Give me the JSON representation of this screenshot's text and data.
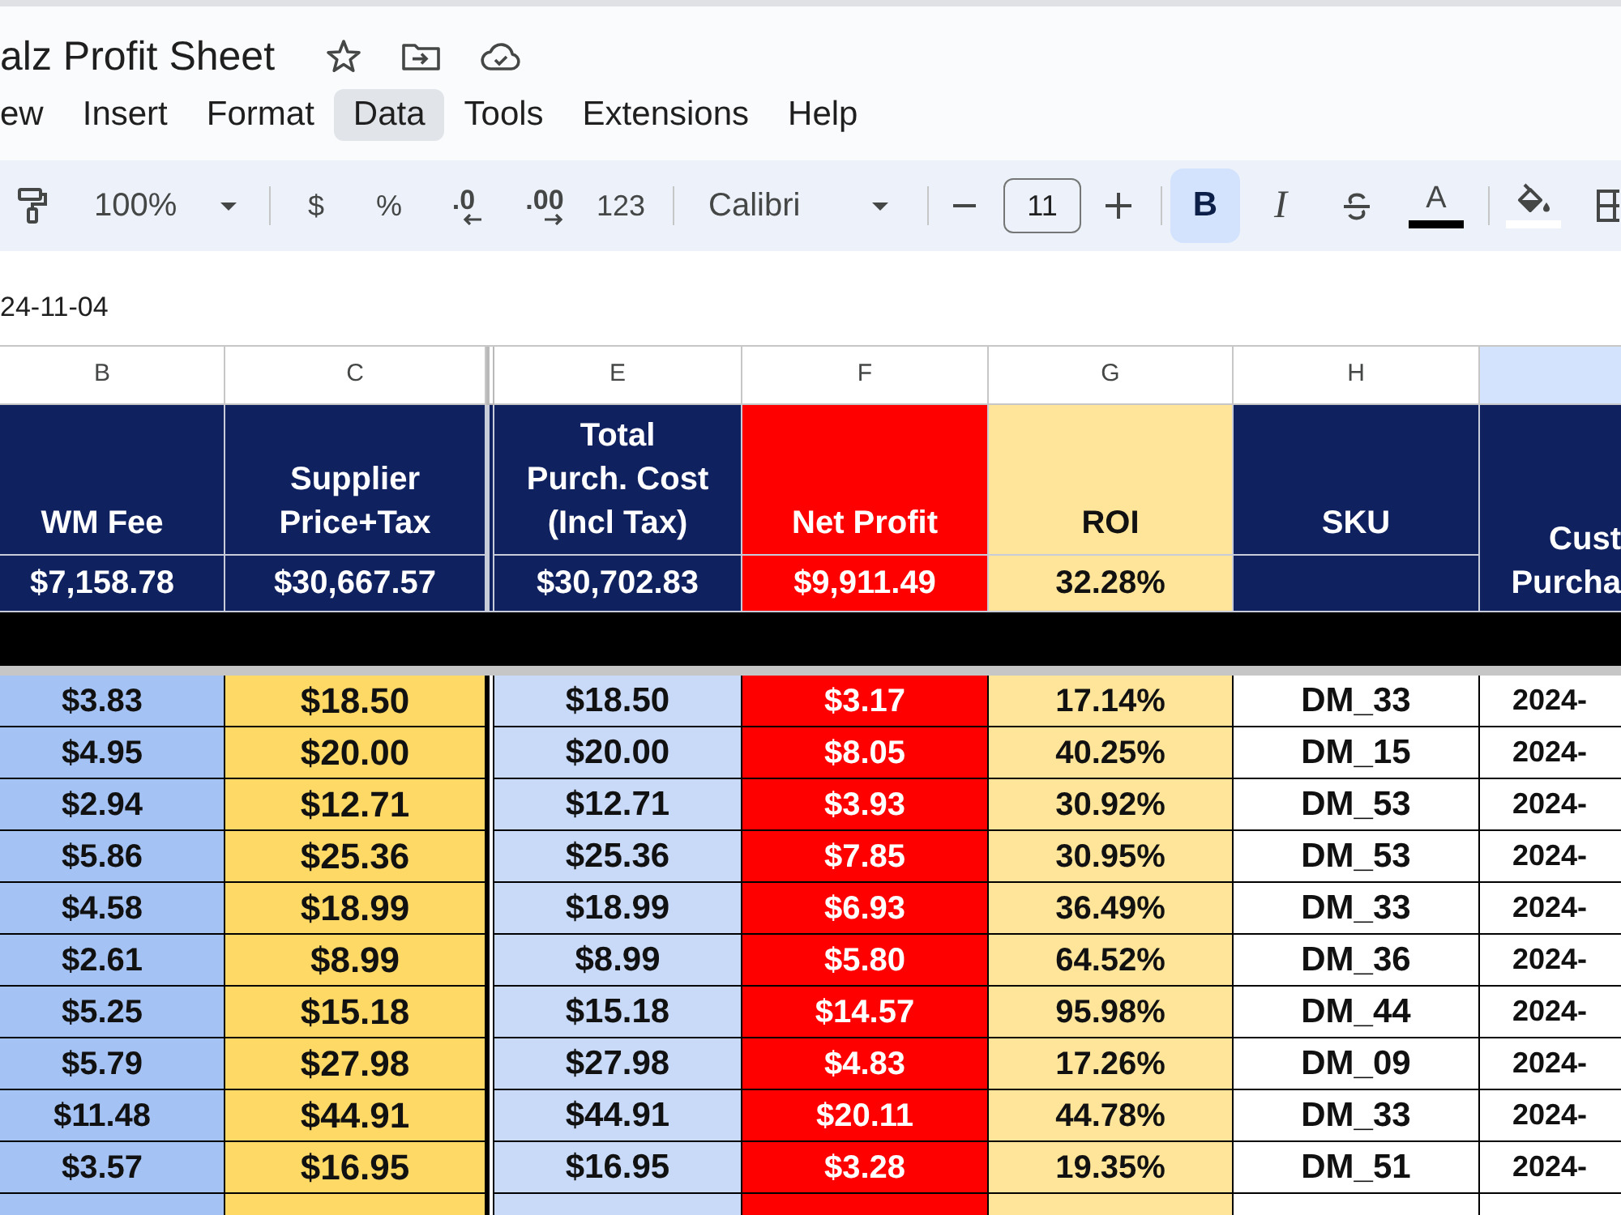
{
  "document": {
    "title": "alz Profit Sheet"
  },
  "menu_bar": [
    {
      "label": "ew",
      "selected": false
    },
    {
      "label": "Insert",
      "selected": false
    },
    {
      "label": "Format",
      "selected": false
    },
    {
      "label": "Data",
      "selected": true
    },
    {
      "label": "Tools",
      "selected": false
    },
    {
      "label": "Extensions",
      "selected": false
    },
    {
      "label": "Help",
      "selected": false
    }
  ],
  "toolbar": {
    "zoom": "100%",
    "number_formats": [
      {
        "kind": "symbol",
        "label": "$"
      },
      {
        "kind": "symbol",
        "label": "%"
      },
      {
        "kind": "decrease_decimals",
        "label": ".0"
      },
      {
        "kind": "increase_decimals",
        "label": ".00"
      },
      {
        "kind": "symbol",
        "label": "123"
      }
    ],
    "font": "Calibri",
    "font_size": "11",
    "text_formats": [
      {
        "kind": "bold",
        "label": "B",
        "selected": true
      },
      {
        "kind": "italic",
        "label": "I",
        "selected": false
      },
      {
        "kind": "strikethrough",
        "selected": false
      },
      {
        "kind": "text_color",
        "label": "A",
        "selected": false
      }
    ]
  },
  "formula_bar": {
    "value": "24-11-04"
  },
  "sheet": {
    "columns": [
      {
        "letter": "B",
        "selected": false,
        "header": {
          "label": "WM Fee",
          "color": "#10215f"
        },
        "total": {
          "label": "$7,158.78",
          "color": "#10215f"
        },
        "color": "#a4c2f4",
        "merged": false,
        "divider_after": false
      },
      {
        "letter": "C",
        "selected": false,
        "header": {
          "label": "Supplier\nPrice+Tax",
          "color": "#10215f"
        },
        "total": {
          "label": "$30,667.57",
          "color": "#10215f"
        },
        "color": "#ffd966",
        "merged": false,
        "divider_after": true
      },
      {
        "letter": "E",
        "selected": false,
        "header": {
          "label": "Total\nPurch. Cost\n(Incl Tax)",
          "color": "#10215f"
        },
        "total": {
          "label": "$30,702.83",
          "color": "#10215f"
        },
        "color": "#c9daf8",
        "merged": false,
        "divider_after": false
      },
      {
        "letter": "F",
        "selected": false,
        "header": {
          "label": "Net Profit",
          "color": "#ff0000"
        },
        "total": {
          "label": "$9,911.49",
          "color": "#ff0000"
        },
        "color": "#ff0000",
        "merged": false,
        "divider_after": false
      },
      {
        "letter": "G",
        "selected": false,
        "header": {
          "label": "ROI",
          "color": "#ffe599"
        },
        "total": {
          "label": "32.28%",
          "color": "#ffe599"
        },
        "color": "#ffe599",
        "merged": false,
        "divider_after": false
      },
      {
        "letter": "H",
        "selected": false,
        "header": {
          "label": "SKU",
          "color": "#10215f"
        },
        "total": {
          "color": "#10215f"
        },
        "color": "#ffffff",
        "merged": false,
        "divider_after": false
      },
      {
        "selected": true,
        "header": {
          "label": "Cust\nPurcha",
          "color": "#10215f"
        },
        "color": "#ffffff",
        "merged": true,
        "divider_after": false
      }
    ],
    "rows": [
      [
        "$3.83",
        "$18.50",
        "$18.50",
        "$3.17",
        "17.14%",
        "DM_33",
        "2024-"
      ],
      [
        "$4.95",
        "$20.00",
        "$20.00",
        "$8.05",
        "40.25%",
        "DM_15",
        "2024-"
      ],
      [
        "$2.94",
        "$12.71",
        "$12.71",
        "$3.93",
        "30.92%",
        "DM_53",
        "2024-"
      ],
      [
        "$5.86",
        "$25.36",
        "$25.36",
        "$7.85",
        "30.95%",
        "DM_53",
        "2024-"
      ],
      [
        "$4.58",
        "$18.99",
        "$18.99",
        "$6.93",
        "36.49%",
        "DM_33",
        "2024-"
      ],
      [
        "$2.61",
        "$8.99",
        "$8.99",
        "$5.80",
        "64.52%",
        "DM_36",
        "2024-"
      ],
      [
        "$5.25",
        "$15.18",
        "$15.18",
        "$14.57",
        "95.98%",
        "DM_44",
        "2024-"
      ],
      [
        "$5.79",
        "$27.98",
        "$27.98",
        "$4.83",
        "17.26%",
        "DM_09",
        "2024-"
      ],
      [
        "$11.48",
        "$44.91",
        "$44.91",
        "$20.11",
        "44.78%",
        "DM_33",
        "2024-"
      ],
      [
        "$3.57",
        "$16.95",
        "$16.95",
        "$3.28",
        "19.35%",
        "DM_51",
        "2024-"
      ]
    ]
  }
}
